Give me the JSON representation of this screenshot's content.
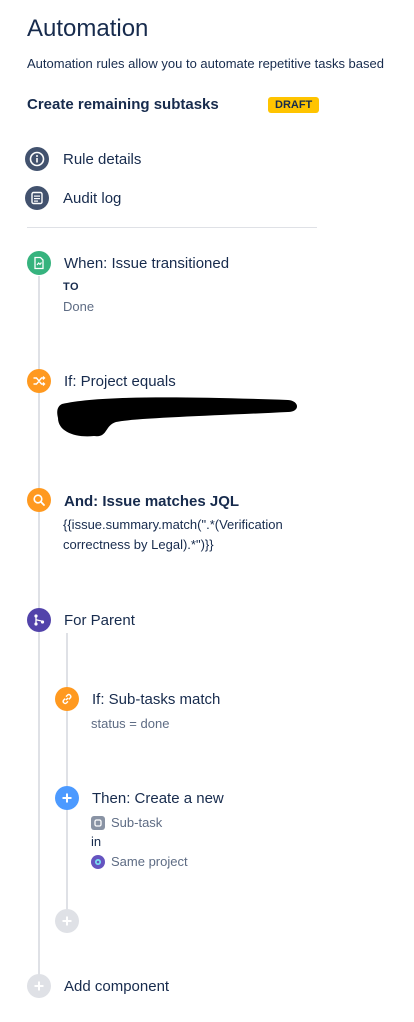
{
  "header": {
    "title": "Automation",
    "description": "Automation rules allow you to automate repetitive tasks based"
  },
  "rule": {
    "name": "Create remaining subtasks",
    "status_badge": "DRAFT"
  },
  "nav": [
    {
      "label": "Rule details",
      "icon": "info-icon"
    },
    {
      "label": "Audit log",
      "icon": "list-icon"
    }
  ],
  "steps": {
    "trigger": {
      "title": "When: Issue transitioned",
      "to_label": "TO",
      "to_value": "Done",
      "color": "#36b37e"
    },
    "condition_project": {
      "title": "If: Project equals",
      "color": "#ff991f"
    },
    "condition_jql": {
      "title": "And: Issue matches JQL",
      "jql": "{{issue.summary.match(\".*(Verification correctness by Legal).*\")}}",
      "color": "#ff991f"
    },
    "branch": {
      "title": "For Parent",
      "color": "#5243aa"
    },
    "nested_condition": {
      "title": "If: Sub-tasks match",
      "detail": "status = done",
      "color": "#ff991f"
    },
    "action": {
      "title": "Then: Create a new",
      "issue_type": "Sub-task",
      "in_label": "in",
      "project": "Same project",
      "color": "#4c9aff"
    }
  },
  "add_component_label": "Add component"
}
